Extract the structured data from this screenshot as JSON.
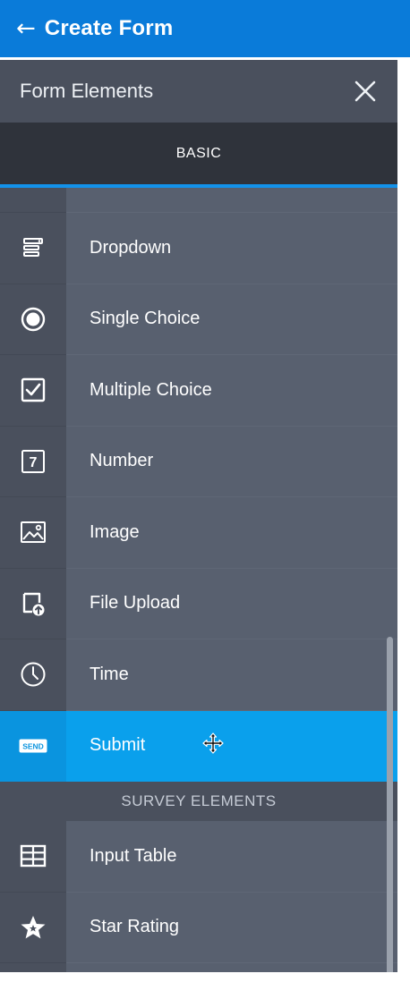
{
  "header": {
    "back_icon": "arrow-left-icon",
    "title": "Create Form",
    "color": "#0a7bd9"
  },
  "panel": {
    "title": "Form Elements",
    "close_icon": "close-icon",
    "tab_label": "BASIC",
    "accent": "#1392ea",
    "items": [
      {
        "label": "Dropdown",
        "icon": "dropdown-icon"
      },
      {
        "label": "Single Choice",
        "icon": "radio-icon"
      },
      {
        "label": "Multiple Choice",
        "icon": "checkbox-icon"
      },
      {
        "label": "Number",
        "icon": "number-icon",
        "glyph": "7"
      },
      {
        "label": "Image",
        "icon": "image-icon"
      },
      {
        "label": "File Upload",
        "icon": "file-upload-icon"
      },
      {
        "label": "Time",
        "icon": "clock-icon"
      },
      {
        "label": "Submit",
        "icon": "send-icon",
        "glyph": "SEND",
        "active": true
      }
    ],
    "section_label": "SURVEY ELEMENTS",
    "survey_items": [
      {
        "label": "Input Table",
        "icon": "table-icon"
      },
      {
        "label": "Star Rating",
        "icon": "star-icon"
      }
    ]
  },
  "cursor": "move-cursor-icon"
}
